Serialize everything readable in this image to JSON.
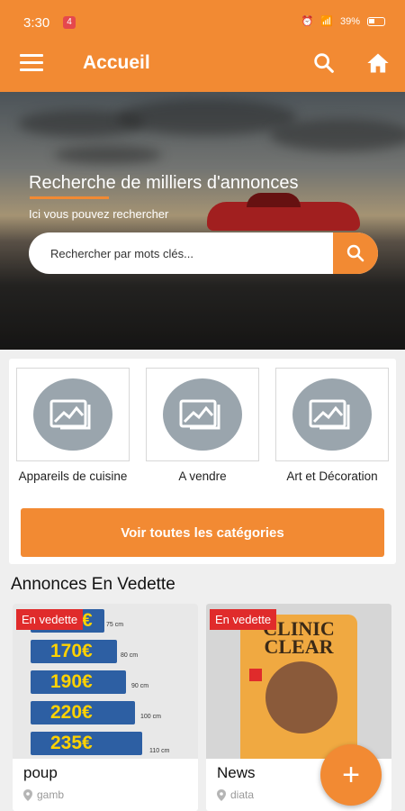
{
  "status_bar": {
    "time": "3:30",
    "notification_badge": "4",
    "battery": "39%"
  },
  "app_bar": {
    "title": "Accueil",
    "menu_icon": "menu-icon",
    "search_icon": "search-icon",
    "home_icon": "home-icon"
  },
  "hero": {
    "title": "Recherche de milliers d'annonces",
    "subtitle": "Ici vous pouvez rechercher",
    "search_placeholder": "Rechercher par mots clés..."
  },
  "categories": {
    "items": [
      {
        "label": "Appareils de cuisine",
        "icon": "image-placeholder-icon"
      },
      {
        "label": "A vendre",
        "icon": "image-placeholder-icon"
      },
      {
        "label": "Art et Décoration",
        "icon": "image-placeholder-icon"
      }
    ],
    "all_button": "Voir toutes les catégories"
  },
  "featured": {
    "title": "Annonces En Vedette",
    "badge": "En vedette",
    "ads": [
      {
        "title": "poup",
        "location": "gamb",
        "image_prices": [
          "150€",
          "170€",
          "190€",
          "220€",
          "235€"
        ],
        "image_dims": [
          "75 cm",
          "80 cm",
          "90 cm",
          "100 cm",
          "110 cm"
        ]
      },
      {
        "title": "News",
        "location": "diata",
        "image_brand_line1": "CLINIC",
        "image_brand_line2": "CLEAR"
      }
    ]
  },
  "fab": {
    "label": "+"
  },
  "colors": {
    "accent": "#f28a33",
    "badge": "#e02b2b",
    "category_circle": "#9aa5ad"
  }
}
